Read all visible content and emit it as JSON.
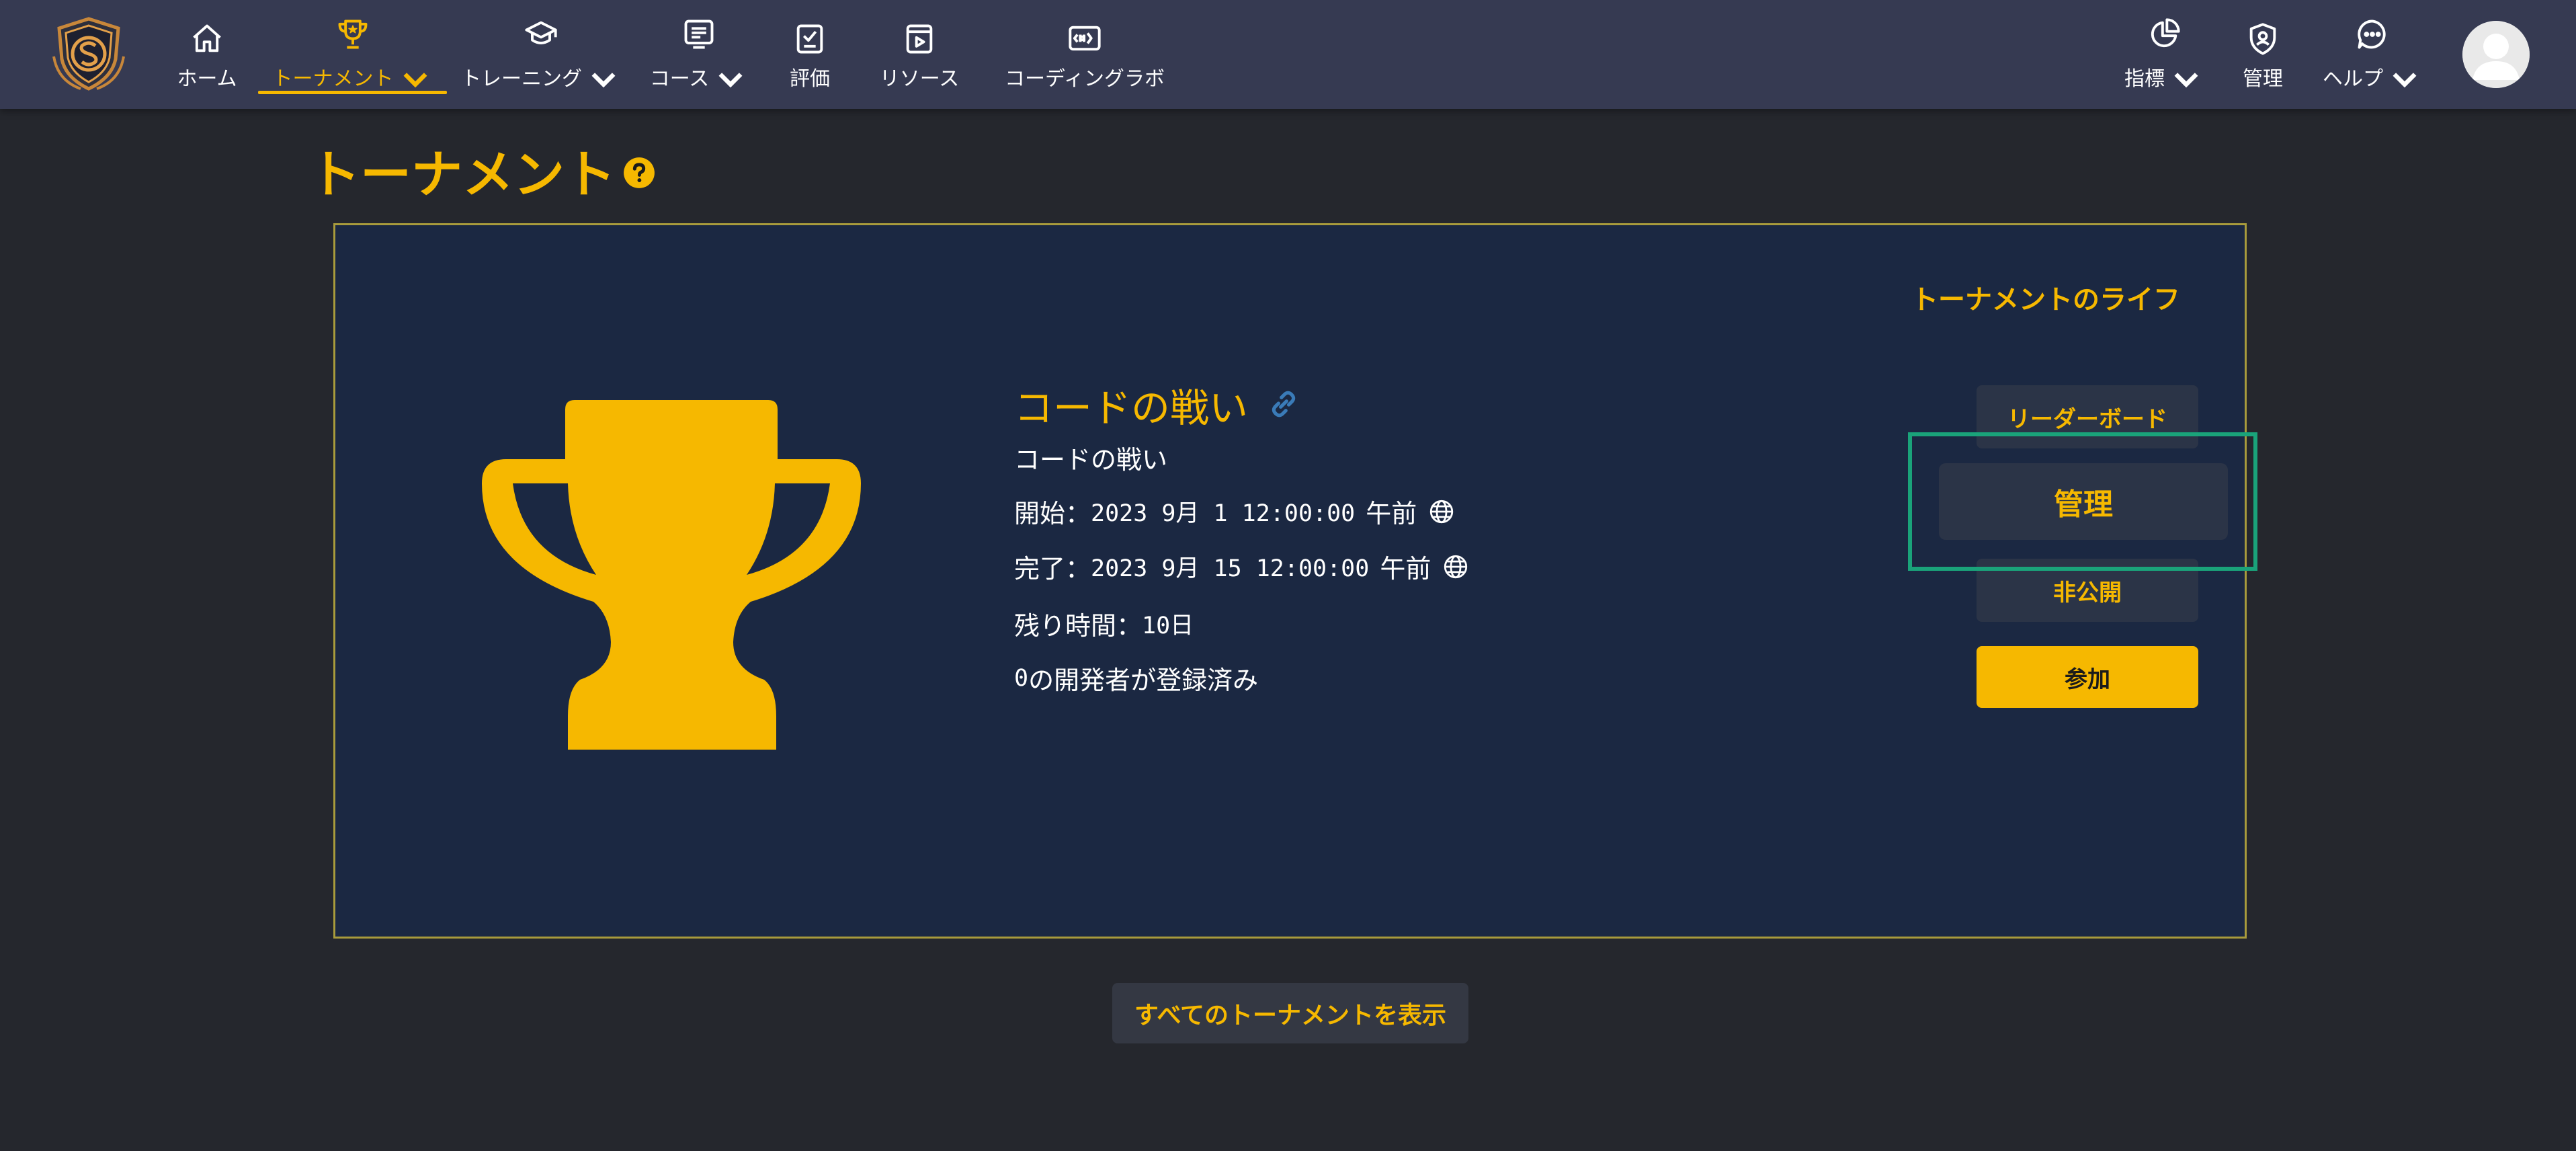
{
  "nav": {
    "items": [
      {
        "label": "ホーム",
        "icon": "home-icon",
        "has_dropdown": false,
        "active": false
      },
      {
        "label": "トーナメント",
        "icon": "trophy-icon",
        "has_dropdown": true,
        "active": true
      },
      {
        "label": "トレーニング",
        "icon": "graduation-cap-icon",
        "has_dropdown": true,
        "active": false
      },
      {
        "label": "コース",
        "icon": "course-list-icon",
        "has_dropdown": true,
        "active": false
      },
      {
        "label": "評価",
        "icon": "assessment-icon",
        "has_dropdown": false,
        "active": false
      },
      {
        "label": "リソース",
        "icon": "play-file-icon",
        "has_dropdown": false,
        "active": false
      },
      {
        "label": "コーディングラボ",
        "icon": "code-lab-icon",
        "has_dropdown": false,
        "active": false
      }
    ],
    "right_items": [
      {
        "label": "指標",
        "icon": "pie-chart-icon",
        "has_dropdown": true
      },
      {
        "label": "管理",
        "icon": "admin-shield-icon",
        "has_dropdown": false
      },
      {
        "label": "ヘルプ",
        "icon": "chat-help-icon",
        "has_dropdown": true
      }
    ]
  },
  "page": {
    "title": "トーナメント"
  },
  "tournament": {
    "life_label": "トーナメントのライフ",
    "name": "コードの戦い",
    "description": "コードの戦い",
    "start_label": "開始：",
    "start_value": "2023 9月 1 12:00:00",
    "start_ampm": "午前",
    "end_label": "完了：",
    "end_value": "2023 9月 15 12:00:00",
    "end_ampm": "午前",
    "remaining_label": "残り時間：",
    "remaining_value": "10日",
    "registered_count": "0",
    "registered_text": "の開発者が登録済み"
  },
  "actions": {
    "leaderboard": "リーダーボード",
    "manage": "管理",
    "private": "非公開",
    "join": "参加"
  },
  "footer": {
    "view_all": "すべてのトーナメントを表示"
  },
  "colors": {
    "accent": "#f6b800",
    "nav_bg": "#363a52",
    "page_bg": "#25272d",
    "card_bg": "#1b2842",
    "highlight": "#1aa37a"
  }
}
